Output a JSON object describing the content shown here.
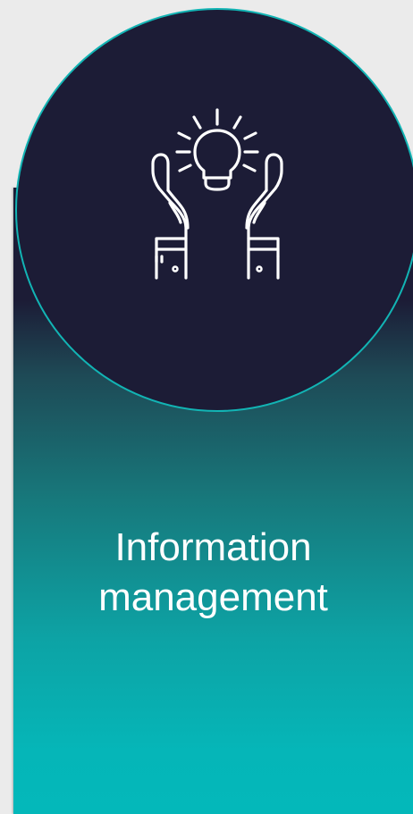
{
  "card": {
    "title_line1": "Information",
    "title_line2": "management",
    "icon": "hands-holding-lightbulb-icon"
  },
  "colors": {
    "background": "#ebebeb",
    "circle_fill": "#1c1c36",
    "circle_border": "#12b4b4",
    "gradient_bottom": "#03b8ba",
    "text": "#ffffff"
  }
}
